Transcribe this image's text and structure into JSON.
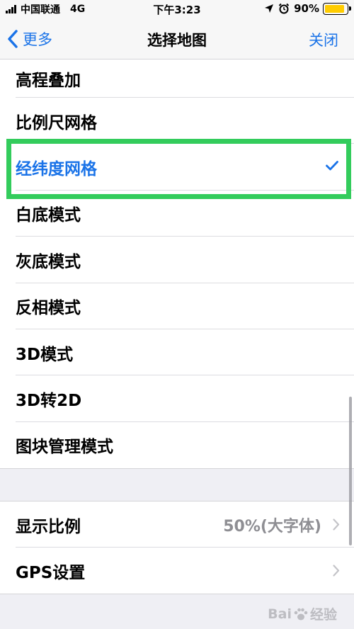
{
  "status_bar": {
    "carrier": "中国联通",
    "network": "4G",
    "time": "下午3:23",
    "battery_percent": "90%",
    "battery_level": 0.9
  },
  "nav": {
    "back_label": "更多",
    "title": "选择地图",
    "close_label": "关闭"
  },
  "map_options": [
    {
      "label": "高程叠加",
      "selected": false
    },
    {
      "label": "比例尺网格",
      "selected": false
    },
    {
      "label": "经纬度网格",
      "selected": true
    },
    {
      "label": "白底模式",
      "selected": false
    },
    {
      "label": "灰底模式",
      "selected": false
    },
    {
      "label": "反相模式",
      "selected": false
    },
    {
      "label": "3D模式",
      "selected": false
    },
    {
      "label": "3D转2D",
      "selected": false
    },
    {
      "label": "图块管理模式",
      "selected": false
    }
  ],
  "settings": {
    "display_scale": {
      "label": "显示比例",
      "value": "50%(大字体)"
    },
    "gps": {
      "label": "GPS设置"
    }
  },
  "watermark": {
    "text_left": "Bai",
    "text_right": "经验"
  },
  "colors": {
    "accent": "#1a73e8",
    "highlight": "#33cc5c",
    "battery": "#ffcc00",
    "background": "#efeff4"
  },
  "icons": [
    "signal-icon",
    "location-arrow-icon",
    "alarm-icon",
    "battery-icon",
    "chevron-left-icon",
    "checkmark-icon",
    "chevron-right-icon",
    "paw-icon"
  ]
}
